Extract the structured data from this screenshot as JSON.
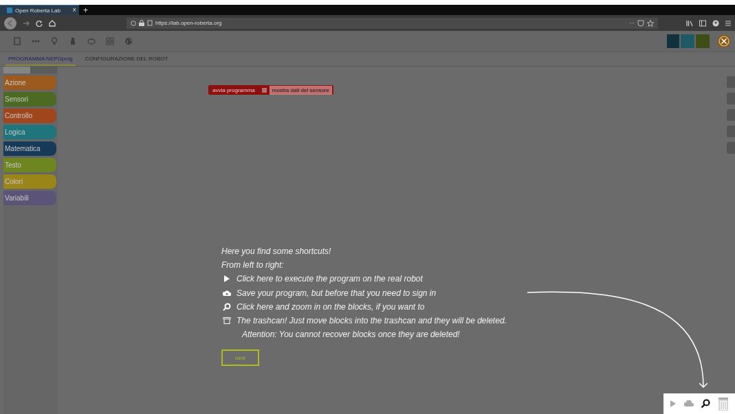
{
  "browser": {
    "tab_title": "Open Roberta Lab",
    "tab_close": "×",
    "new_tab": "+",
    "url": "https://lab.open-roberta.org",
    "page_actions": "···"
  },
  "tabs": [
    {
      "label": "PROGRAMMA NEPOprog",
      "selected": true
    },
    {
      "label": "CONFIGURAZIONE DEL ROBOT",
      "selected": false
    }
  ],
  "toolbox": [
    {
      "label": "Azione",
      "color": "#9c5a1e"
    },
    {
      "label": "Sensori",
      "color": "#4c6a22"
    },
    {
      "label": "Controllo",
      "color": "#a0461c"
    },
    {
      "label": "Logica",
      "color": "#1e767c"
    },
    {
      "label": "Matematica",
      "color": "#173a58"
    },
    {
      "label": "Testo",
      "color": "#6d8620"
    },
    {
      "label": "Colori",
      "color": "#9a8618"
    },
    {
      "label": "Variabili",
      "color": "#5c5478"
    }
  ],
  "start_block": {
    "label": "avvia programma",
    "checkbox_label": "mostra dati del sensore",
    "checked": false
  },
  "tour": {
    "lines": [
      {
        "kind": "text",
        "text": "Here you find some shortcuts!"
      },
      {
        "kind": "text",
        "text": "From left to right:"
      },
      {
        "kind": "play",
        "text": "Click here to execute the program on the real robot"
      },
      {
        "kind": "cloud",
        "text": "Save your program, but before that you need to sign in"
      },
      {
        "kind": "zoom",
        "text": "Click here and zoom in on the blocks, if you want to"
      },
      {
        "kind": "trash",
        "text": "The trashcan! Just move blocks into the trashcan and they will be deleted."
      },
      {
        "kind": "indent",
        "text": "Attention: You cannot recover blocks once they are deleted!"
      }
    ],
    "button": "next"
  }
}
